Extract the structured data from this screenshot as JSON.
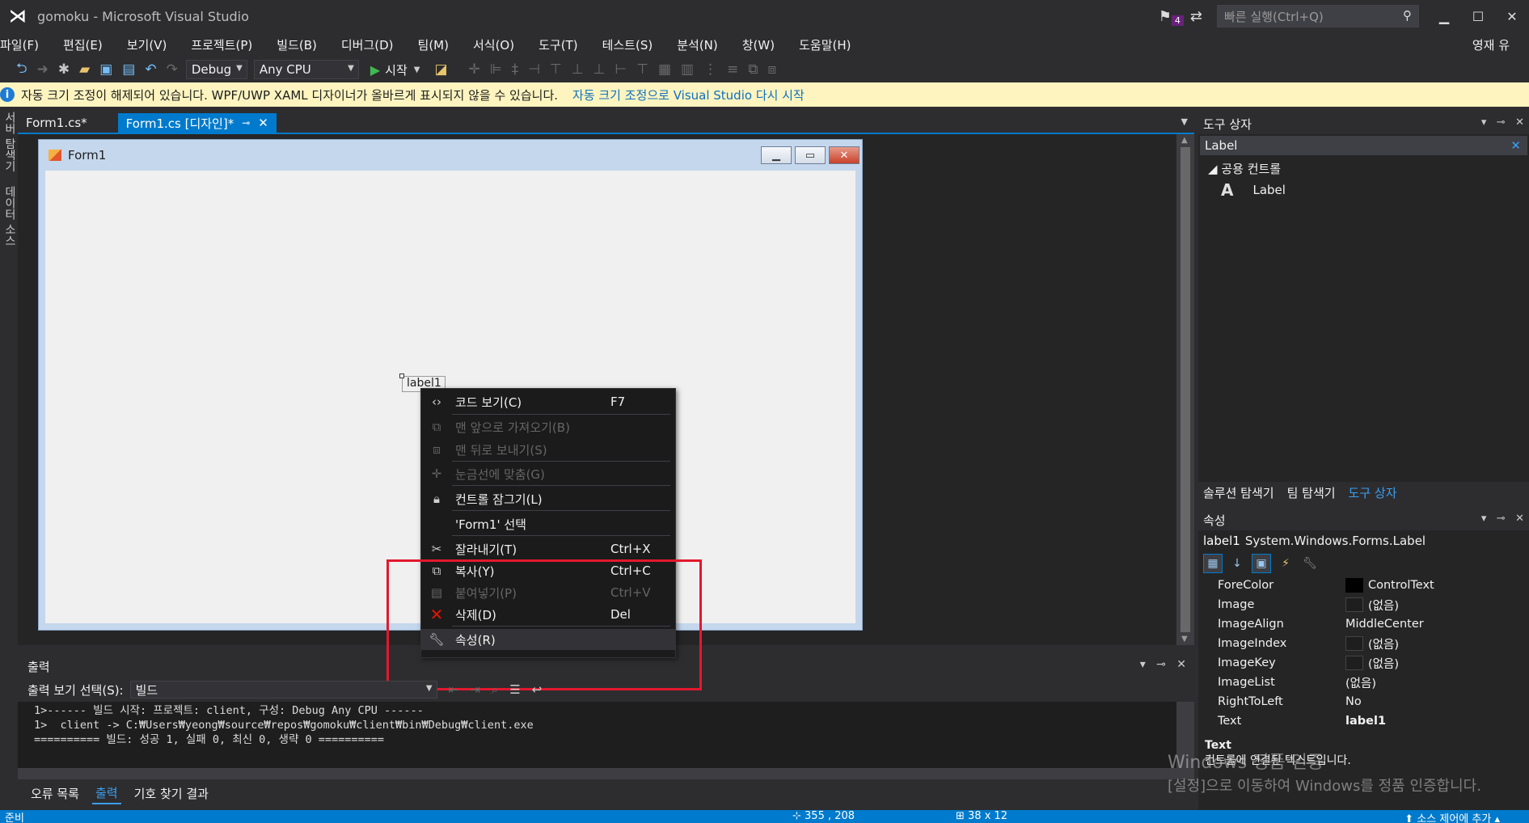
{
  "window": {
    "title": "gomoku - Microsoft Visual Studio",
    "notification_count": "4",
    "quick_launch_placeholder": "빠른 실행(Ctrl+Q)",
    "user": "영재 유"
  },
  "menu": [
    "파일(F)",
    "편집(E)",
    "보기(V)",
    "프로젝트(P)",
    "빌드(B)",
    "디버그(D)",
    "팀(M)",
    "서식(O)",
    "도구(T)",
    "테스트(S)",
    "분석(N)",
    "창(W)",
    "도움말(H)"
  ],
  "toolbar": {
    "config": "Debug",
    "platform": "Any CPU",
    "start_label": "시작"
  },
  "infobar": {
    "message": "자동 크기 조정이 해제되어 있습니다. WPF/UWP XAML 디자이너가 올바르게 표시되지 않을 수 있습니다.",
    "link": "자동 크기 조정으로 Visual Studio 다시 시작"
  },
  "left_strip": {
    "tab1": "서버 탐색기",
    "tab2": "데이터 소스"
  },
  "doc_tabs": [
    {
      "label": "Form1.cs*"
    },
    {
      "label": "Form1.cs [디자인]*"
    }
  ],
  "form1": {
    "title": "Form1",
    "label_text": "label1"
  },
  "context_menu": [
    {
      "label": "코드 보기(C)",
      "shortcut": "F7",
      "icon": "code-icon",
      "enabled": true
    },
    {
      "label": "맨 앞으로 가져오기(B)",
      "shortcut": "",
      "icon": "bring-front-icon",
      "enabled": false
    },
    {
      "label": "맨 뒤로 보내기(S)",
      "shortcut": "",
      "icon": "send-back-icon",
      "enabled": false
    },
    {
      "label": "눈금선에 맞춤(G)",
      "shortcut": "",
      "icon": "align-grid-icon",
      "enabled": false
    },
    {
      "label": "컨트롤 잠그기(L)",
      "shortcut": "",
      "icon": "lock-icon",
      "enabled": true
    },
    {
      "label": "'Form1' 선택",
      "shortcut": "",
      "icon": "",
      "enabled": true
    },
    {
      "label": "잘라내기(T)",
      "shortcut": "Ctrl+X",
      "icon": "cut-icon",
      "enabled": true
    },
    {
      "label": "복사(Y)",
      "shortcut": "Ctrl+C",
      "icon": "copy-icon",
      "enabled": true
    },
    {
      "label": "붙여넣기(P)",
      "shortcut": "Ctrl+V",
      "icon": "paste-icon",
      "enabled": false
    },
    {
      "label": "삭제(D)",
      "shortcut": "Del",
      "icon": "delete-icon",
      "enabled": true
    },
    {
      "label": "속성(R)",
      "shortcut": "",
      "icon": "wrench-icon",
      "enabled": true
    }
  ],
  "output": {
    "title": "출력",
    "select_label": "출력 보기 선택(S):",
    "select_value": "빌드",
    "lines": [
      "1>------ 빌드 시작: 프로젝트: client, 구성: Debug Any CPU ------",
      "1>  client -> C:₩Users₩yeong₩source₩repos₩gomoku₩client₩bin₩Debug₩client.exe",
      "========== 빌드: 성공 1, 실패 0, 최신 0, 생략 0 =========="
    ]
  },
  "bottom_tabs": [
    "오류 목록",
    "출력",
    "기호 찾기 결과"
  ],
  "toolbox": {
    "title": "도구 상자",
    "search_value": "Label",
    "group": "공용 컨트롤",
    "item": "Label"
  },
  "right_tabs": [
    "솔루션 탐색기",
    "팀 탐색기",
    "도구 상자"
  ],
  "properties": {
    "title": "속성",
    "object_name": "label1",
    "object_type": "System.Windows.Forms.Label",
    "rows": [
      {
        "name": "ForeColor",
        "value": "ControlText",
        "swatch": "#000000"
      },
      {
        "name": "Image",
        "value": "(없음)",
        "swatch": "#1e1e1e"
      },
      {
        "name": "ImageAlign",
        "value": "MiddleCenter",
        "swatch": ""
      },
      {
        "name": "ImageIndex",
        "value": "(없음)",
        "swatch": "#1e1e1e"
      },
      {
        "name": "ImageKey",
        "value": "(없음)",
        "swatch": "#1e1e1e"
      },
      {
        "name": "ImageList",
        "value": "(없음)",
        "swatch": ""
      },
      {
        "name": "RightToLeft",
        "value": "No",
        "swatch": ""
      },
      {
        "name": "Text",
        "value": "label1",
        "swatch": ""
      }
    ],
    "desc_title": "Text",
    "desc_text": "컨트롤에 연결된 텍스트입니다."
  },
  "watermark": {
    "line1": "Windows 정품 인증",
    "line2": "[설정]으로 이동하여 Windows를 정품 인증합니다."
  },
  "status": {
    "ready": "준비",
    "position": "355 , 208",
    "size": "38 x 12",
    "scm": "소스 제어에 추가"
  }
}
